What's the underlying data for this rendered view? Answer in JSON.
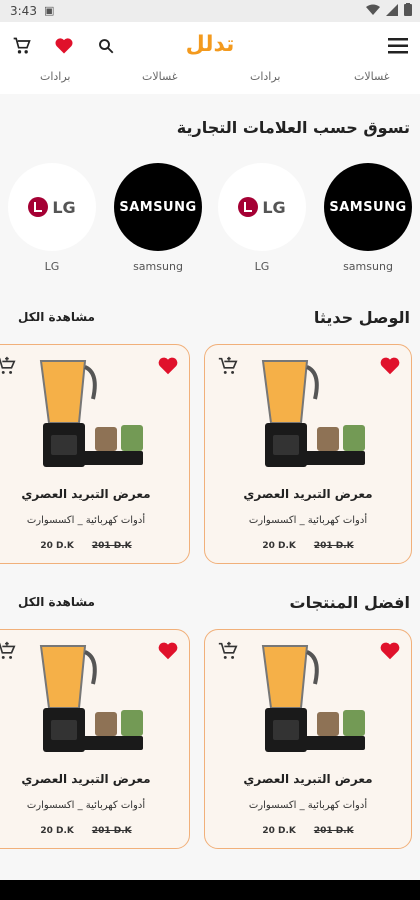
{
  "status": {
    "time": "3:43"
  },
  "header": {
    "title": "تدلل"
  },
  "categories_strip": [
    "غسالات",
    "برادات",
    "غسالات",
    "برادات"
  ],
  "brands_section": {
    "title": "تسوق حسب العلامات التجارية",
    "brands": [
      {
        "name": "samsung",
        "logo_text": "SAMSUNG"
      },
      {
        "name": "LG",
        "logo_text": "LG"
      },
      {
        "name": "samsung",
        "logo_text": "SAMSUNG"
      },
      {
        "name": "LG",
        "logo_text": "LG"
      }
    ]
  },
  "new_arrivals": {
    "title": "الوصل حديثا",
    "see_all": "مشاهدة الكل",
    "products": [
      {
        "name": "معرض التبريد العصري",
        "category": "أدوات كهربائية _ اكسسوارت",
        "price": "20 D.K",
        "old_price": "201 D.K"
      },
      {
        "name": "معرض التبريد العصري",
        "category": "أدوات كهربائية _ اكسسوارت",
        "price": "20 D.K",
        "old_price": "201 D.K"
      }
    ]
  },
  "best_products": {
    "title": "افضل المنتجات",
    "see_all": "مشاهدة الكل",
    "products": [
      {
        "name": "معرض التبريد العصري",
        "category": "أدوات كهربائية _ اكسسوارت",
        "price": "20 D.K",
        "old_price": "201 D.K"
      },
      {
        "name": "معرض التبريد العصري",
        "category": "أدوات كهربائية _ اكسسوارت",
        "price": "20 D.K",
        "old_price": "201 D.K"
      }
    ]
  },
  "colors": {
    "accent": "#f39a1e",
    "heart": "#e0112b",
    "card_border": "#f1b07a"
  }
}
